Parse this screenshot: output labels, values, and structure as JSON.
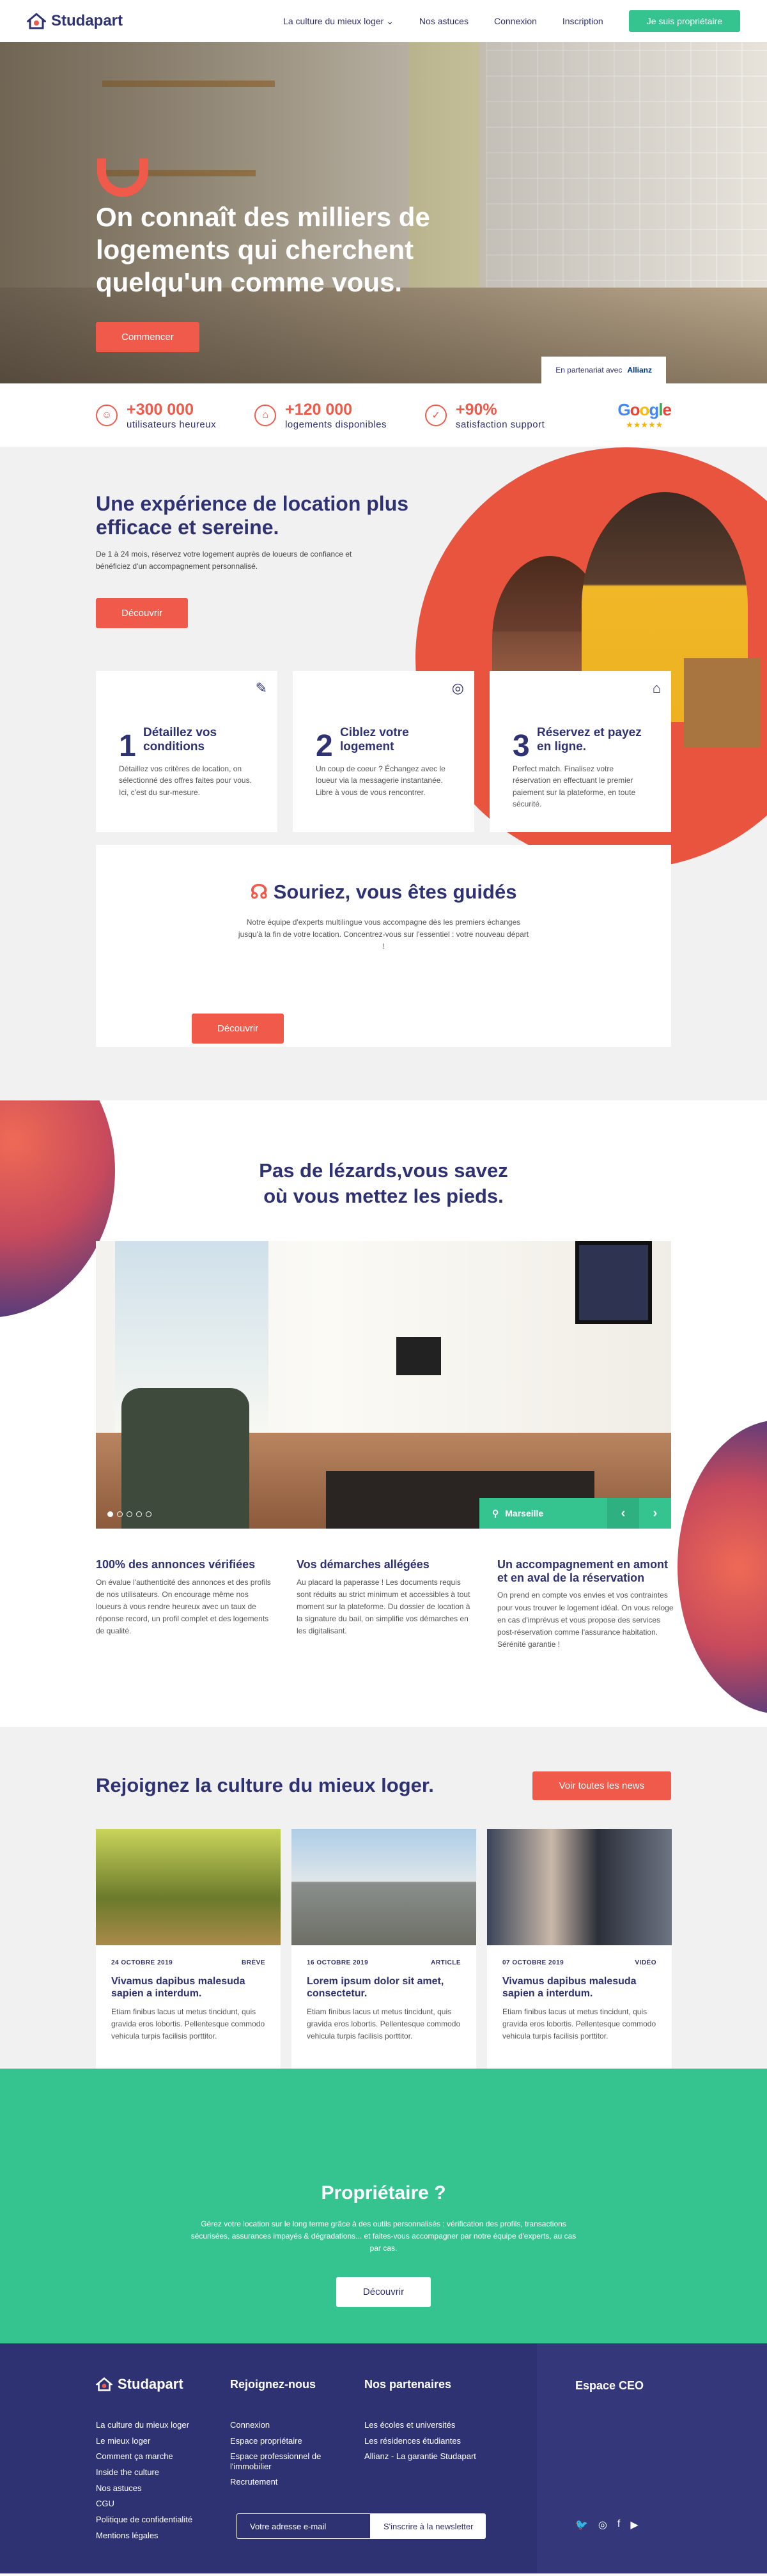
{
  "header": {
    "logo": "Studapart",
    "nav": [
      "La culture du mieux loger",
      "Nos astuces",
      "Connexion",
      "Inscription"
    ],
    "cta": "Je suis propriétaire"
  },
  "hero": {
    "title": "On connaît des milliers de logements qui cherchent quelqu'un comme vous.",
    "button": "Commencer",
    "partner_text": "En partenariat avec",
    "partner_brand": "Allianz"
  },
  "stats": [
    {
      "num": "+300 000",
      "label": "utilisateurs heureux",
      "icon": "user-icon"
    },
    {
      "num": "+120 000",
      "label": "logements disponibles",
      "icon": "house-icon"
    },
    {
      "num": "+90%",
      "label": "satisfaction support",
      "icon": "check-icon"
    }
  ],
  "google": {
    "name": "Google",
    "stars": "★★★★★"
  },
  "experience": {
    "title": "Une expérience de location plus efficace et sereine.",
    "subtitle": "De 1 à 24 mois, réservez votre logement auprès de loueurs de confiance et bénéficiez d'un accompagnement personnalisé.",
    "button": "Découvrir",
    "cards": [
      {
        "n": "1",
        "title": "Détaillez vos conditions",
        "desc": "Détaillez vos critères de location, on sélectionné des offres faites pour vous. Ici, c'est du sur-mesure."
      },
      {
        "n": "2",
        "title": "Ciblez votre logement",
        "desc": "Un coup de coeur ? Échangez avec le loueur via la messagerie instantanée. Libre à vous de vous rencontrer."
      },
      {
        "n": "3",
        "title": "Réservez et payez en ligne.",
        "desc": "Perfect match. Finalisez votre réservation en effectuant le premier paiement sur la plateforme, en toute sécurité."
      }
    ]
  },
  "guide": {
    "title": "Souriez, vous êtes guidés",
    "desc": "Notre équipe d'experts multilingue vous accompagne dès les premiers échanges jusqu'à la fin de votre location. Concentrez-vous sur l'essentiel : votre nouveau départ !",
    "button": "Découvrir"
  },
  "lizards": {
    "title_line1": "Pas de lézards,vous savez",
    "title_line2": "où vous mettez les pieds.",
    "city": "Marseille",
    "features": [
      {
        "title": "100% des annonces vérifiées",
        "desc": "On évalue l'authenticité des annonces et des profils de nos utilisateurs. On encourage même nos loueurs à vous rendre heureux avec un taux de réponse record, un profil complet et des logements de qualité."
      },
      {
        "title": "Vos démarches allégées",
        "desc": "Au placard la paperasse ! Les documents requis sont réduits au strict minimum et accessibles à tout moment sur la plateforme. Du dossier de location à la signature du bail, on simplifie vos démarches en les digitalisant."
      },
      {
        "title": "Un accompagnement en amont et en aval de la réservation",
        "desc": "On prend en compte vos envies et vos contraintes pour vous trouver le logement idéal. On vous reloge en cas d'imprévus et vous propose des services post-réservation comme l'assurance habitation. Sérénité garantie !"
      }
    ]
  },
  "news": {
    "title": "Rejoignez la culture du mieux loger.",
    "button": "Voir toutes les news",
    "items": [
      {
        "date": "24 OCTOBRE 2019",
        "tag": "BRÈVE",
        "title": "Vivamus dapibus malesuda sapien a interdum.",
        "desc": "Etiam finibus lacus ut metus tincidunt, quis gravida eros lobortis. Pellentesque commodo vehicula turpis facilisis porttitor."
      },
      {
        "date": "16 OCTOBRE 2019",
        "tag": "ARTICLE",
        "title": "Lorem ipsum dolor sit amet, consectetur.",
        "desc": "Etiam finibus lacus ut metus tincidunt, quis gravida eros lobortis. Pellentesque commodo vehicula turpis facilisis porttitor."
      },
      {
        "date": "07 OCTOBRE 2019",
        "tag": "VIDÉO",
        "title": "Vivamus dapibus malesuda sapien a interdum.",
        "desc": "Etiam finibus lacus ut metus tincidunt, quis gravida eros lobortis. Pellentesque commodo vehicula turpis facilisis porttitor."
      }
    ]
  },
  "owner": {
    "title": "Propriétaire ?",
    "desc": "Gérez votre location sur le long terme grâce à des outils personnalisés : vérification des profils, transactions sécurisées, assurances impayés & dégradations... et faites-vous accompagner par notre équipe d'experts, au cas par cas.",
    "button": "Découvrir"
  },
  "footer": {
    "logo": "Studapart",
    "col1": [
      "La culture du mieux loger",
      "Le mieux loger",
      "Comment ça marche",
      "Inside the culture",
      "Nos astuces",
      "CGU",
      "Politique de confidentialité",
      "Mentions légales"
    ],
    "col2_title": "Rejoignez-nous",
    "col2": [
      "Connexion",
      "Espace propriétaire",
      "Espace professionnel de l'immobilier",
      "Recrutement"
    ],
    "col3_title": "Nos partenaires",
    "col3": [
      "Les écoles et universités",
      "Les résidences étudiantes",
      "Allianz - La garantie Studapart"
    ],
    "newsletter_placeholder": "Votre adresse e-mail",
    "newsletter_button": "S'inscrire à la newsletter",
    "ceo": "Espace CEO"
  }
}
